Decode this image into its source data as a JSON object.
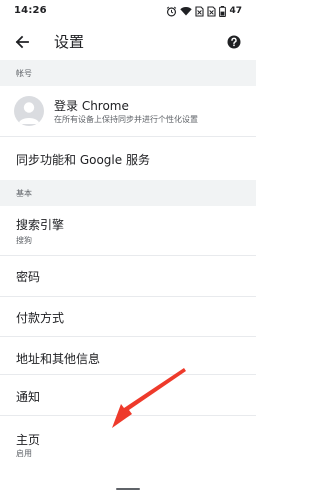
{
  "status_bar": {
    "time": "14:26",
    "battery_level": "47",
    "icons": [
      "alarm-icon",
      "wifi-icon",
      "no-sim-icon",
      "no-sim-icon",
      "battery-icon"
    ]
  },
  "app_bar": {
    "back_icon": "back-arrow-icon",
    "title": "设置",
    "help_icon": "help-icon"
  },
  "sections": {
    "account_header": "帐号",
    "basic_header": "基本"
  },
  "account": {
    "signin_title": "登录 Chrome",
    "signin_subtitle": "在所有设备上保持同步并进行个性化设置",
    "sync_title": "同步功能和 Google 服务"
  },
  "basic": {
    "search_engine_title": "搜索引擎",
    "search_engine_value": "搜狗",
    "passwords_title": "密码",
    "payment_title": "付款方式",
    "addresses_title": "地址和其他信息",
    "notifications_title": "通知",
    "homepage_title": "主页",
    "homepage_value": "启用"
  },
  "colors": {
    "section_background": "#f1f3f4",
    "annotation_arrow": "#ee3a2b"
  }
}
